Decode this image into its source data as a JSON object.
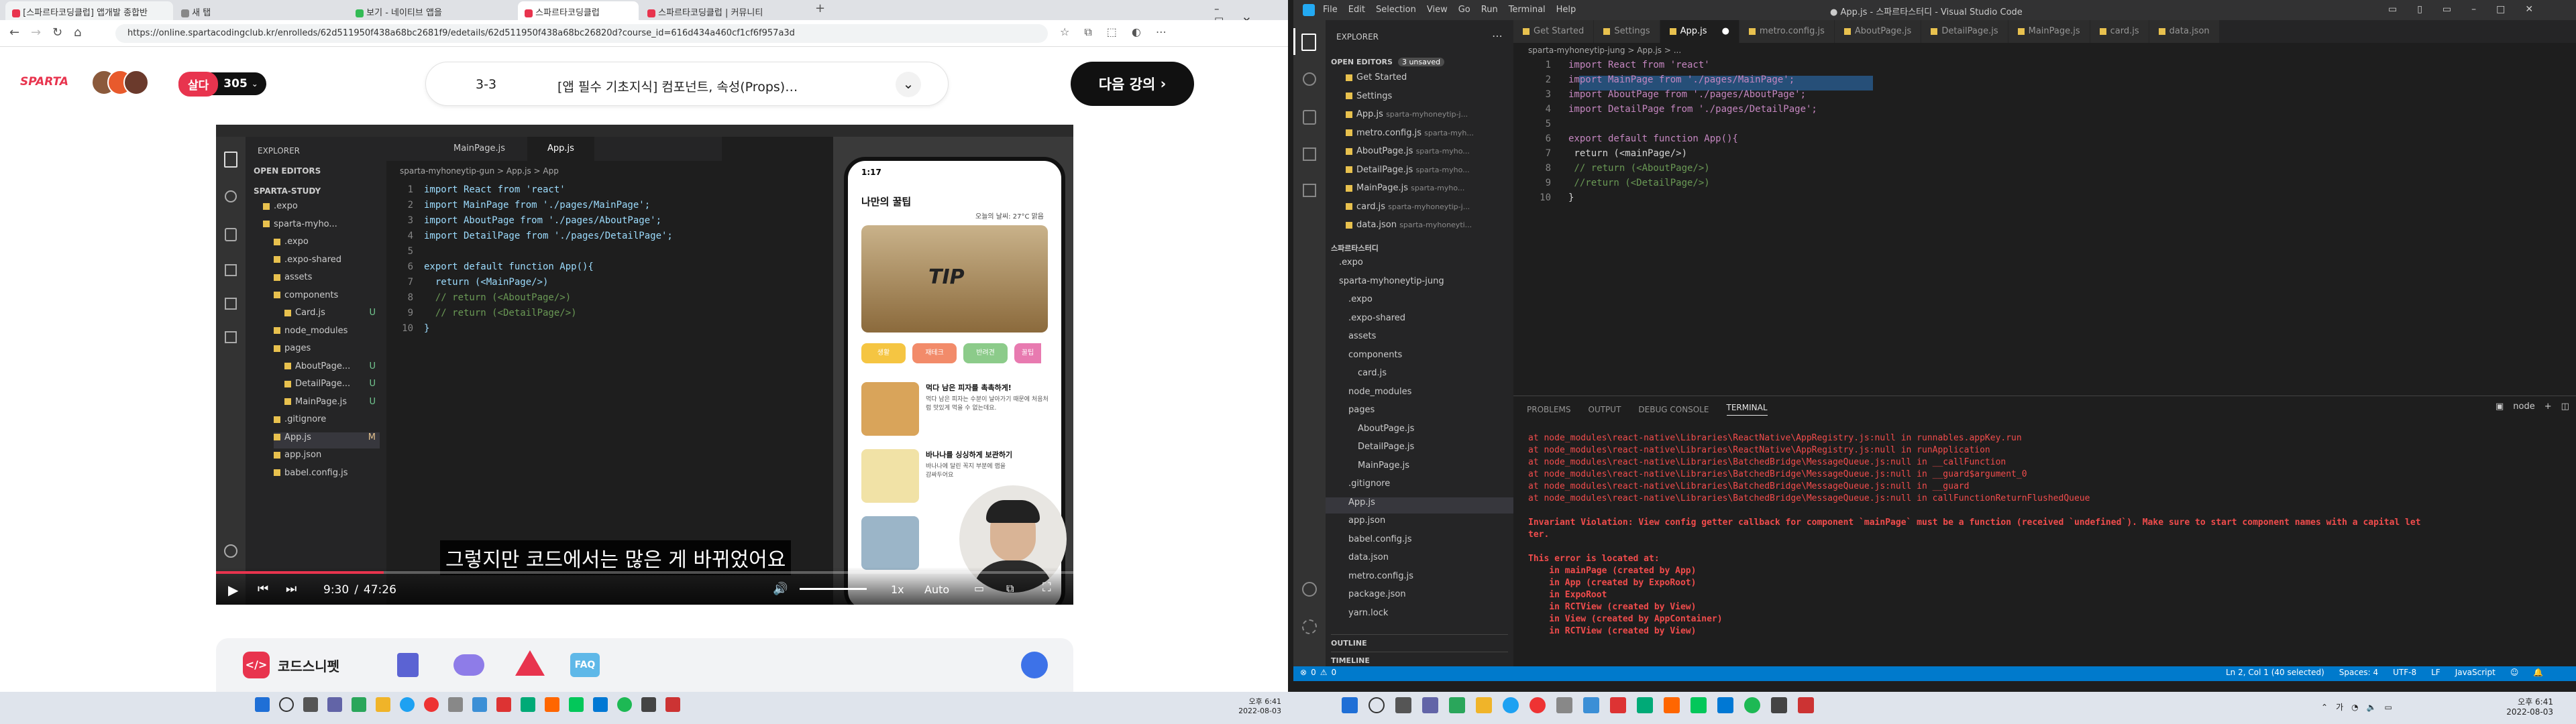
{
  "browser": {
    "tabs": [
      {
        "label": "[스파르타코딩클럽] 앱개발 종합반"
      },
      {
        "label": "새 탭"
      },
      {
        "label": "보기 - 네이티브 앱을"
      },
      {
        "label": "스파르타코딩클럽"
      },
      {
        "label": "스파르타코딩클럽 | 커뮤니티"
      }
    ],
    "url": "https://online.spartacodingclub.kr/enrolleds/62d511950f438a68bc2681f9/edetails/62d511950f438a68bc26820d?course_id=616d434a460cf1cf6f957a3d"
  },
  "lecture": {
    "logo": "SPARTA",
    "badge": "살다",
    "count": "305",
    "lesson_number": "3-3",
    "lesson_title": "[앱 필수 기초지식] 컴포넌트, 속성(Props)…",
    "next_button": "다음 강의"
  },
  "video": {
    "explorer_title": "EXPLORER",
    "open_editors": "OPEN EDITORS",
    "project": "SPARTA-STUDY",
    "tree": [
      {
        "name": ".expo",
        "indent": 1
      },
      {
        "name": "sparta-myho...",
        "indent": 1
      },
      {
        "name": ".expo",
        "indent": 2
      },
      {
        "name": ".expo-shared",
        "indent": 2
      },
      {
        "name": "assets",
        "indent": 2
      },
      {
        "name": "components",
        "indent": 2
      },
      {
        "name": "Card.js",
        "indent": 3,
        "badge": "U"
      },
      {
        "name": "node_modules",
        "indent": 2
      },
      {
        "name": "pages",
        "indent": 2
      },
      {
        "name": "AboutPage...",
        "indent": 3,
        "badge": "U"
      },
      {
        "name": "DetailPage...",
        "indent": 3,
        "badge": "U"
      },
      {
        "name": "MainPage.js",
        "indent": 3,
        "badge": "U"
      },
      {
        "name": ".gitignore",
        "indent": 2
      },
      {
        "name": "App.js",
        "indent": 2,
        "badge": "M"
      },
      {
        "name": "app.json",
        "indent": 2
      },
      {
        "name": "babel.config.js",
        "indent": 2
      }
    ],
    "tabs": [
      "MainPage.js",
      "App.js"
    ],
    "breadcrumb": "sparta-myhoneytip-gun > App.js > App",
    "code": [
      "import React from 'react'",
      "import MainPage from './pages/MainPage';",
      "import AboutPage from './pages/AboutPage';",
      "import DetailPage from './pages/DetailPage';",
      "",
      "export default function App(){",
      "  return (<MainPage/>)",
      "  // return (<AboutPage/>)",
      "  // return (<DetailPage/>)",
      "}"
    ],
    "phone": {
      "time": "1:17",
      "title": "나만의 꿀팁",
      "weather": "오늘의 날씨: 27°C 맑음",
      "tip_label": "TIP",
      "cats": [
        "생활",
        "재테크",
        "반려견",
        "꿀팁"
      ],
      "items": [
        {
          "title": "먹다 남은 피자를 촉촉하게!",
          "desc": "먹다 남은 피자는 수분이 날아가기 때문에 처음처럼 맛있게 먹을 수 없는데요."
        },
        {
          "title": "바나나를 싱싱하게 보관하기",
          "desc": "바나나에 달린 꼭지 부분에 랩을 감싸두어요"
        }
      ]
    },
    "subtitle": "그렇지만 코드에서는 많은 게 바뀌었어요",
    "current_time": "9:30",
    "separator": "/",
    "duration": "47:26",
    "speed": "1x",
    "quality": "Auto",
    "progress": 0.196
  },
  "appbar": {
    "brand": "코드스니펫",
    "faq": "FAQ"
  },
  "vscode": {
    "title": "● App.js - 스파르타스터디 - Visual Studio Code",
    "menu": [
      "File",
      "Edit",
      "Selection",
      "View",
      "Go",
      "Run",
      "Terminal",
      "Help"
    ],
    "tabs": [
      {
        "label": "Get Started"
      },
      {
        "label": "Settings"
      },
      {
        "label": "App.js",
        "active": true
      },
      {
        "label": "metro.config.js"
      },
      {
        "label": "AboutPage.js"
      },
      {
        "label": "DetailPage.js"
      },
      {
        "label": "MainPage.js"
      },
      {
        "label": "card.js"
      },
      {
        "label": "data.json"
      }
    ],
    "explorer_title": "EXPLORER",
    "open_editors": "OPEN EDITORS",
    "unsaved": "3 unsaved",
    "open_files": [
      {
        "name": "Get Started",
        "path": ""
      },
      {
        "name": "Settings",
        "path": ""
      },
      {
        "name": "App.js",
        "path": "sparta-myhoneytip-j..."
      },
      {
        "name": "metro.config.js",
        "path": "sparta-myh..."
      },
      {
        "name": "AboutPage.js",
        "path": "sparta-myho..."
      },
      {
        "name": "DetailPage.js",
        "path": "sparta-myho..."
      },
      {
        "name": "MainPage.js",
        "path": "sparta-myho..."
      },
      {
        "name": "card.js",
        "path": "sparta-myhoneytip-j..."
      },
      {
        "name": "data.json",
        "path": "sparta-myhoneyti..."
      }
    ],
    "project": "스파르타스터디",
    "tree": [
      {
        "name": ".expo",
        "indent": 1
      },
      {
        "name": "sparta-myhoneytip-jung",
        "indent": 1
      },
      {
        "name": ".expo",
        "indent": 2
      },
      {
        "name": ".expo-shared",
        "indent": 2
      },
      {
        "name": "assets",
        "indent": 2
      },
      {
        "name": "components",
        "indent": 2
      },
      {
        "name": "card.js",
        "indent": 3
      },
      {
        "name": "node_modules",
        "indent": 2
      },
      {
        "name": "pages",
        "indent": 2
      },
      {
        "name": "AboutPage.js",
        "indent": 3
      },
      {
        "name": "DetailPage.js",
        "indent": 3
      },
      {
        "name": "MainPage.js",
        "indent": 3
      },
      {
        "name": ".gitignore",
        "indent": 2
      },
      {
        "name": "App.js",
        "indent": 2
      },
      {
        "name": "app.json",
        "indent": 2
      },
      {
        "name": "babel.config.js",
        "indent": 2
      },
      {
        "name": "data.json",
        "indent": 2
      },
      {
        "name": "metro.config.js",
        "indent": 2
      },
      {
        "name": "package.json",
        "indent": 2
      },
      {
        "name": "yarn.lock",
        "indent": 2
      }
    ],
    "outline": "OUTLINE",
    "timeline": "TIMELINE",
    "breadcrumb": "sparta-myhoneytip-jung > App.js > ...",
    "code": [
      "import React from 'react'",
      "import MainPage from './pages/MainPage';",
      "import AboutPage from './pages/AboutPage';",
      "import DetailPage from './pages/DetailPage';",
      "",
      "export default function App(){",
      " return (<mainPage/>)",
      " // return (<AboutPage/>)",
      " //return (<DetailPage/>)",
      "}"
    ],
    "panel_tabs": [
      "PROBLEMS",
      "OUTPUT",
      "DEBUG CONSOLE",
      "TERMINAL"
    ],
    "terminal_kind": "node",
    "terminal": [
      "at node_modules\\react-native\\Libraries\\ReactNative\\AppRegistry.js:null in runnables.appKey.run",
      "at node_modules\\react-native\\Libraries\\ReactNative\\AppRegistry.js:null in runApplication",
      "at node_modules\\react-native\\Libraries\\BatchedBridge\\MessageQueue.js:null in __callFunction",
      "at node_modules\\react-native\\Libraries\\BatchedBridge\\MessageQueue.js:null in __guard$argument_0",
      "at node_modules\\react-native\\Libraries\\BatchedBridge\\MessageQueue.js:null in __guard",
      "at node_modules\\react-native\\Libraries\\BatchedBridge\\MessageQueue.js:null in callFunctionReturnFlushedQueue",
      "",
      "Invariant Violation: View config getter callback for component `mainPage` must be a function (received `undefined`). Make sure to start component names with a capital let",
      "ter.",
      "",
      "This error is located at:",
      "    in mainPage (created by App)",
      "    in App (created by ExpoRoot)",
      "    in ExpoRoot",
      "    in RCTView (created by View)",
      "    in View (created by AppContainer)",
      "    in RCTView (created by View)"
    ],
    "status": {
      "errors": "0",
      "warnings": "0",
      "position": "Ln 2, Col 1 (40 selected)",
      "spaces": "Spaces: 4",
      "encoding": "UTF-8",
      "eol": "LF",
      "language": "JavaScript"
    }
  },
  "taskbar": {
    "time": "오후 6:41",
    "date": "2022-08-03",
    "lang": "가"
  },
  "colors": {
    "sparta_red": "#e8344e",
    "vscode_blue": "#007acc",
    "error_red": "#f14c4c"
  }
}
